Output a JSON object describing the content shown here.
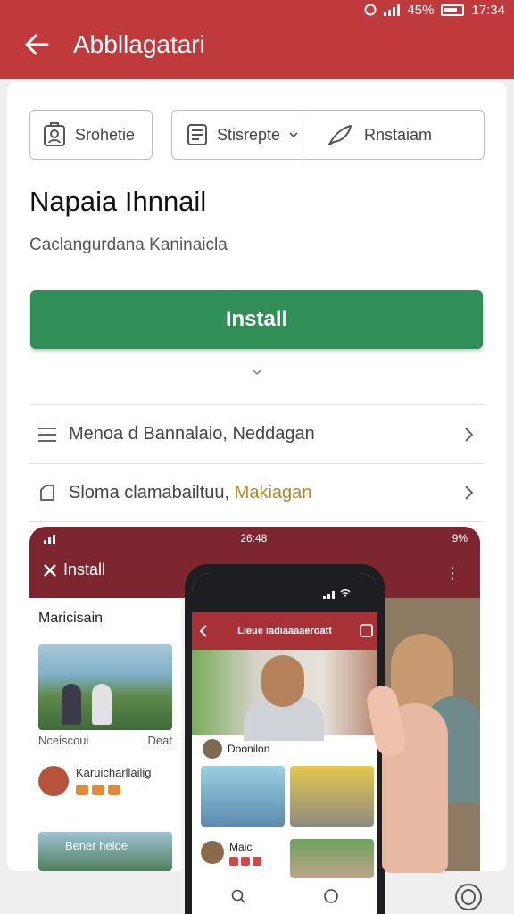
{
  "status_bar": {
    "battery_text": "45%",
    "time": "17:34"
  },
  "app_bar": {
    "title": "Abbllagatari"
  },
  "chips": {
    "chip1": "Srohetie",
    "chip2": "Stisrepte",
    "chip3": "Rnstaiam"
  },
  "app": {
    "name": "Napaia Ihnnail",
    "subtitle": "Caclangurdana Kaninaicla",
    "install_label": "Install"
  },
  "rows": [
    {
      "text": "Menoa d Bannalaio, Neddagan"
    },
    {
      "text_prefix": "Sloma clamabailtuu, ",
      "highlight": "Makiagan"
    }
  ],
  "preview": {
    "status_time": "26:48",
    "status_battery": "9%",
    "title": "Install",
    "heading": "Maricisain",
    "caption_left": "Nceiscoui",
    "caption_right": "Deat",
    "item_name": "Karuicharllailig",
    "banner": "Bener heloe"
  },
  "phone": {
    "title": "Lieue iadiaaaaeroatt",
    "author": "Doonilon",
    "item_name": "Maic"
  },
  "colors": {
    "app_bar": "#c0393b",
    "install": "#2f8f56",
    "highlight": "#b08a2a"
  }
}
